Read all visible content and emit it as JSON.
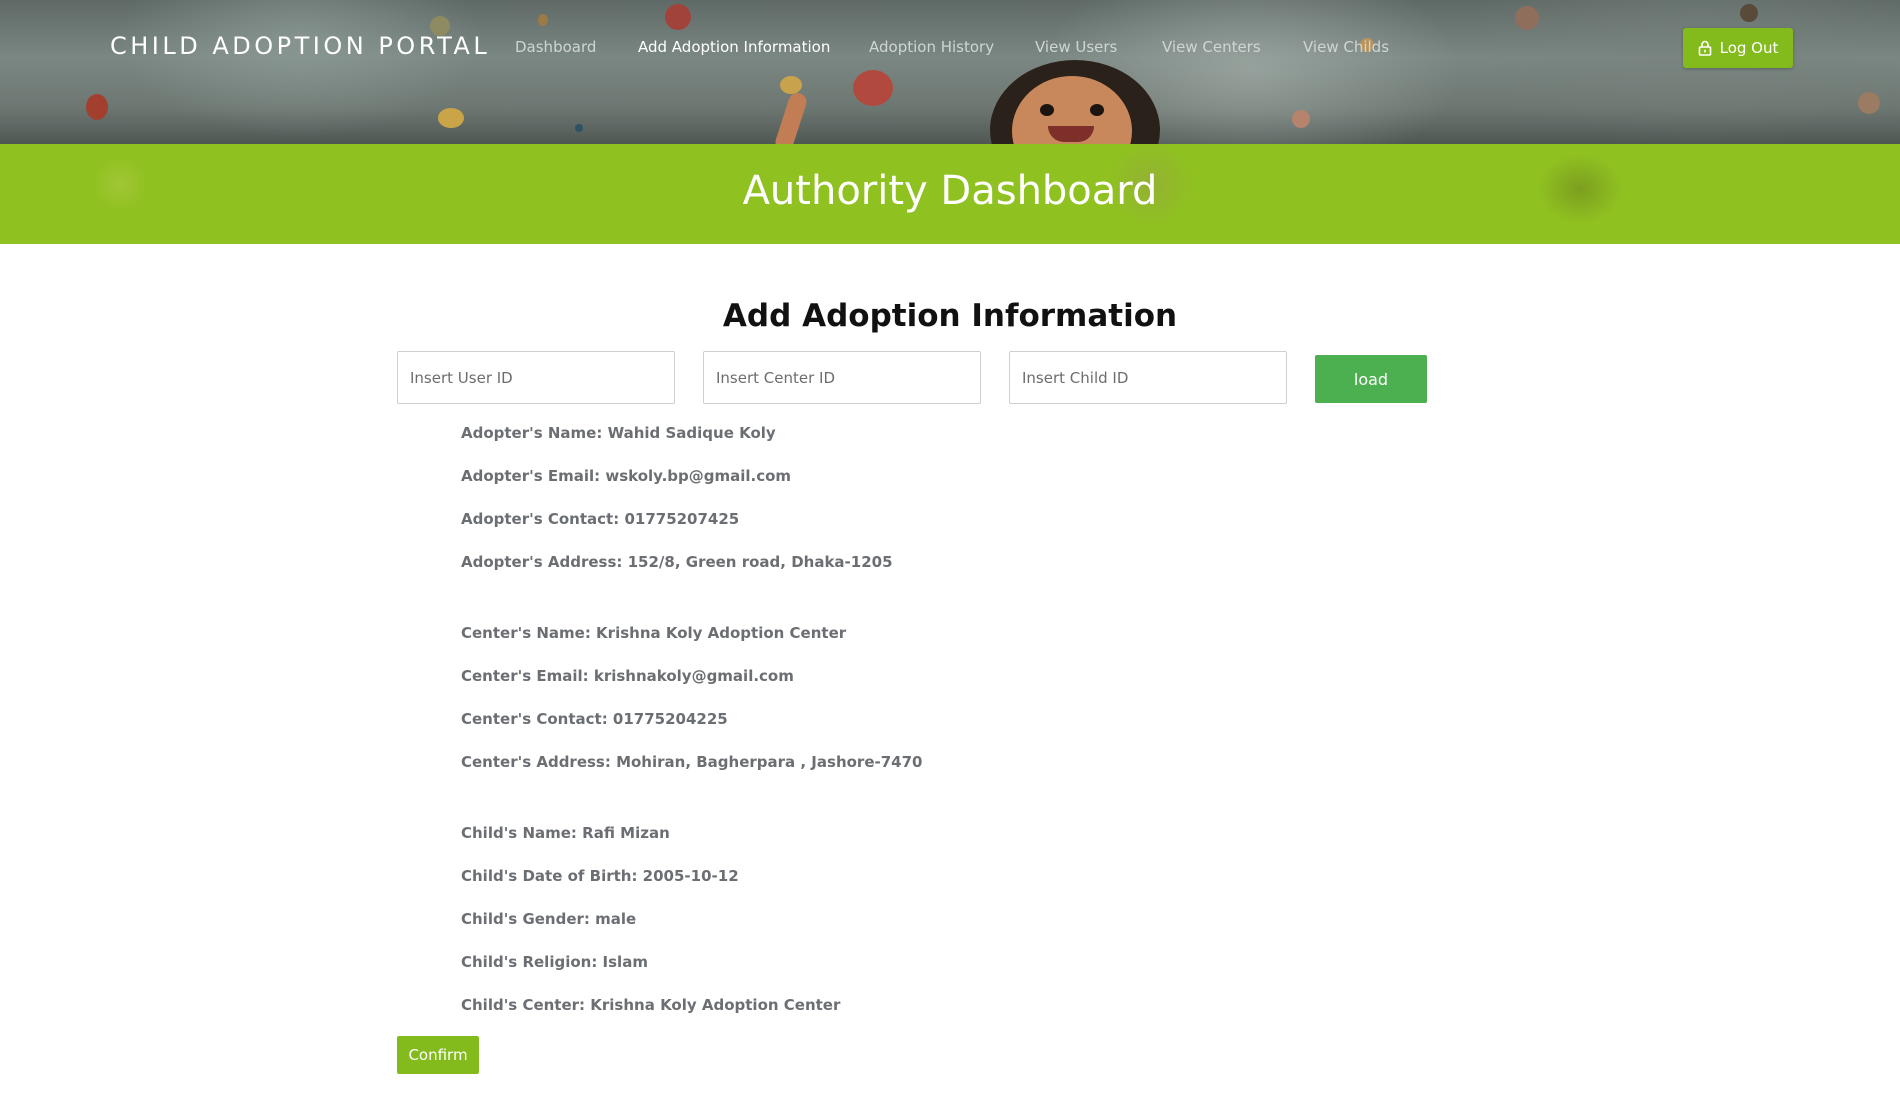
{
  "header": {
    "brand": "CHILD ADOPTION PORTAL",
    "nav": [
      {
        "label": "Dashboard",
        "active": false
      },
      {
        "label": "Add Adoption Information",
        "active": true
      },
      {
        "label": "Adoption History",
        "active": false
      },
      {
        "label": "View Users",
        "active": false
      },
      {
        "label": "View Centers",
        "active": false
      },
      {
        "label": "View Childs",
        "active": false
      }
    ],
    "logout_label": "Log Out",
    "logout_icon": "lock-icon"
  },
  "banner": {
    "title": "Authority Dashboard"
  },
  "form": {
    "heading": "Add Adoption Information",
    "user_id": {
      "placeholder": "Insert User ID",
      "value": ""
    },
    "center_id": {
      "placeholder": "Insert Center ID",
      "value": ""
    },
    "child_id": {
      "placeholder": "Insert Child ID",
      "value": ""
    },
    "load_label": "load"
  },
  "adopter": [
    "Adopter's Name: Wahid Sadique Koly",
    "Adopter's Email: wskoly.bp@gmail.com",
    "Adopter's Contact: 01775207425",
    "Adopter's Address: 152/8, Green road, Dhaka-1205"
  ],
  "center": [
    "Center's Name: Krishna Koly Adoption Center",
    "Center's Email: krishnakoly@gmail.com",
    "Center's Contact: 01775204225",
    "Center's Address: Mohiran, Bagherpara , Jashore-7470"
  ],
  "child": [
    "Child's Name: Rafi Mizan",
    "Child's Date of Birth: 2005-10-12",
    "Child's Gender: male",
    "Child's Religion: Islam",
    "Child's Center: Krishna Koly Adoption Center"
  ],
  "confirm_label": "Confirm",
  "colors": {
    "accent_green": "#84bb1c",
    "banner_green": "#8fc121",
    "load_green": "#4caf50",
    "info_text": "#6b6f73"
  }
}
